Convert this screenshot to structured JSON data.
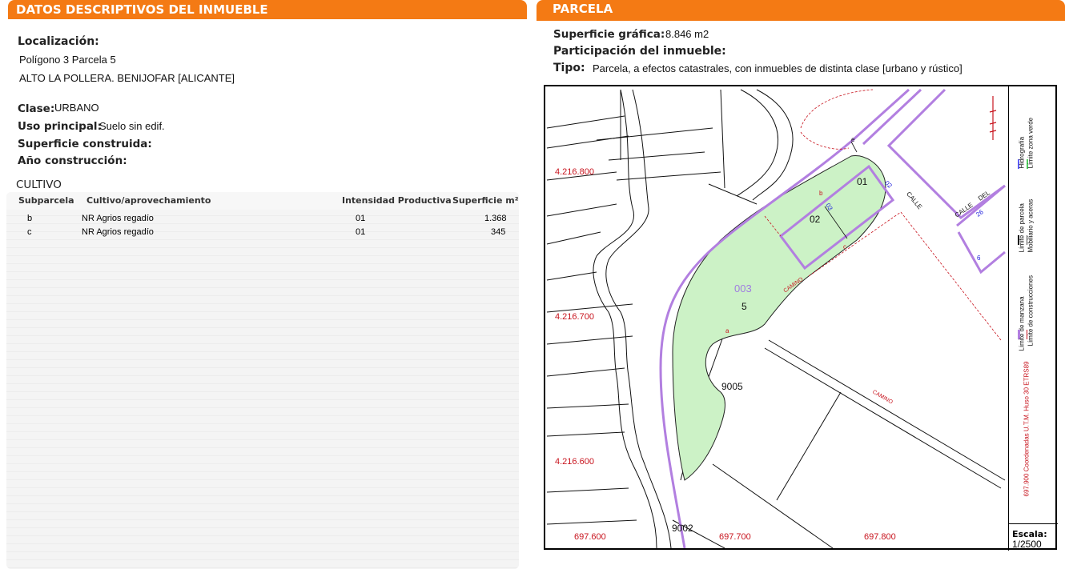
{
  "left_header": "DATOS DESCRIPTIVOS DEL INMUEBLE",
  "right_header": "PARCELA",
  "localizacion": {
    "label": "Localización:",
    "line1": "Polígono 3 Parcela 5",
    "line2": "ALTO LA POLLERA. BENIJOFAR [ALICANTE]"
  },
  "clase": {
    "label": "Clase:",
    "value": "URBANO"
  },
  "uso": {
    "label": "Uso principal:",
    "value": "Suelo sin edif."
  },
  "superficie_construida": {
    "label": "Superficie construida:"
  },
  "ano": {
    "label": "Año construcción:"
  },
  "cultivo": {
    "title": "CULTIVO",
    "headers": [
      "Subparcela",
      "Cultivo/aprovechamiento",
      "Intensidad Productiva",
      "Superficie m²"
    ],
    "rows": [
      {
        "sub": "b",
        "cultivo": "NR Agrios regadío",
        "intensidad": "01",
        "superficie": "1.368"
      },
      {
        "sub": "c",
        "cultivo": "NR Agrios regadío",
        "intensidad": "01",
        "superficie": "345"
      }
    ]
  },
  "parcela": {
    "superficie_label": "Superficie gráfica:",
    "superficie_value": "8.846 m2",
    "participacion_label": "Participación del inmueble:",
    "tipo_label": "Tipo:",
    "tipo_value": "Parcela, a efectos catastrales, con inmuebles de distinta clase [urbano y rústico]"
  },
  "map": {
    "y_labels": [
      "4.216.800",
      "4.216.700",
      "4.216.600"
    ],
    "x_labels": [
      "697.600",
      "697.700",
      "697.800"
    ],
    "parcel_code": "003",
    "parcel_number": "5",
    "sub_01": "01",
    "sub_02": "02",
    "road_9005": "9005",
    "road_9002": "9002",
    "sub_a": "a",
    "sub_b": "b",
    "sub_c": "c",
    "camino1": "CAMINO",
    "camino2": "CAMINO",
    "calle1": "CALLE",
    "calle2": "CALLE",
    "del": "DEL",
    "num_02": "02",
    "num_03": "03",
    "num_26": "26",
    "num_6": "6",
    "num_e": "e"
  },
  "legend": {
    "manzana": "Límite de manzana",
    "parcela": "Límite de parcela",
    "hidrografia": "Hidrografía",
    "construcciones": "Límite de construcciones",
    "mobiliario": "Mobiliario y aceras",
    "zona_verde": "Límite zona verde",
    "coords": "697.900 Coordenadas U.T.M. Huso 30 ETRS89"
  },
  "scale": {
    "label": "Escala:",
    "value": "1/2500"
  },
  "colors": {
    "orange": "#f47a14",
    "parcel_border": "#b27fe0",
    "green_fill": "#ccf2c6",
    "red_label": "#c8141e"
  }
}
